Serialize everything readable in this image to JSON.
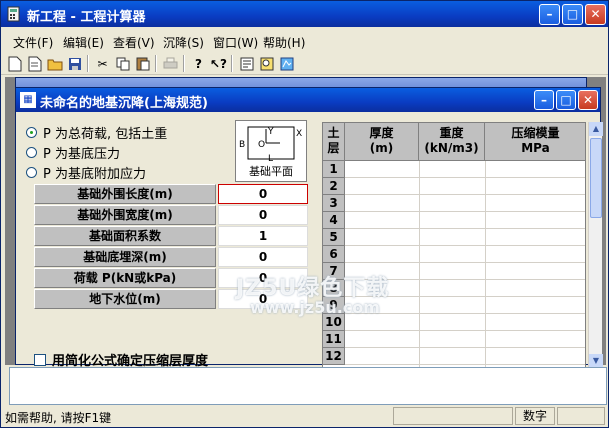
{
  "app": {
    "title": "新工程 - 工程计算器",
    "menu": [
      "文件(F)",
      "编辑(E)",
      "查看(V)",
      "沉降(S)",
      "窗口(W)",
      "帮助(H)"
    ]
  },
  "child": {
    "title": "未命名的地基沉降(上海规范)",
    "load_options": [
      {
        "label": "P 为总荷载, 包括土重",
        "selected": true
      },
      {
        "label": "P 为基底压力",
        "selected": false
      },
      {
        "label": "P 为基底附加应力",
        "selected": false
      }
    ],
    "diagram": {
      "caption": "基础平面",
      "labels": [
        "B",
        "O",
        "Y",
        "X",
        "L"
      ]
    },
    "fields": [
      {
        "label": "基础外围长度(m)",
        "value": "0"
      },
      {
        "label": "基础外围宽度(m)",
        "value": "0"
      },
      {
        "label": "基础面积系数",
        "value": "1"
      },
      {
        "label": "基础底埋深(m)",
        "value": "0"
      },
      {
        "label": "荷载 P(kN或kPa)",
        "value": "0"
      },
      {
        "label": "地下水位(m)",
        "value": "0"
      }
    ],
    "checkbox_label": "用简化公式确定压缩层厚度",
    "grid": {
      "headers": [
        "土\n层",
        "厚度\n(m)",
        "重度\n(kN/m3)",
        "压缩模量\nMPa"
      ],
      "rows": [
        "1",
        "2",
        "3",
        "4",
        "5",
        "6",
        "7",
        "8",
        "9",
        "10",
        "11",
        "12"
      ]
    }
  },
  "watermark": [
    "JZ5U绿色下载",
    "www.jz5u.com"
  ],
  "status": {
    "message": "如需帮助, 请按F1键",
    "mode": "数字"
  }
}
